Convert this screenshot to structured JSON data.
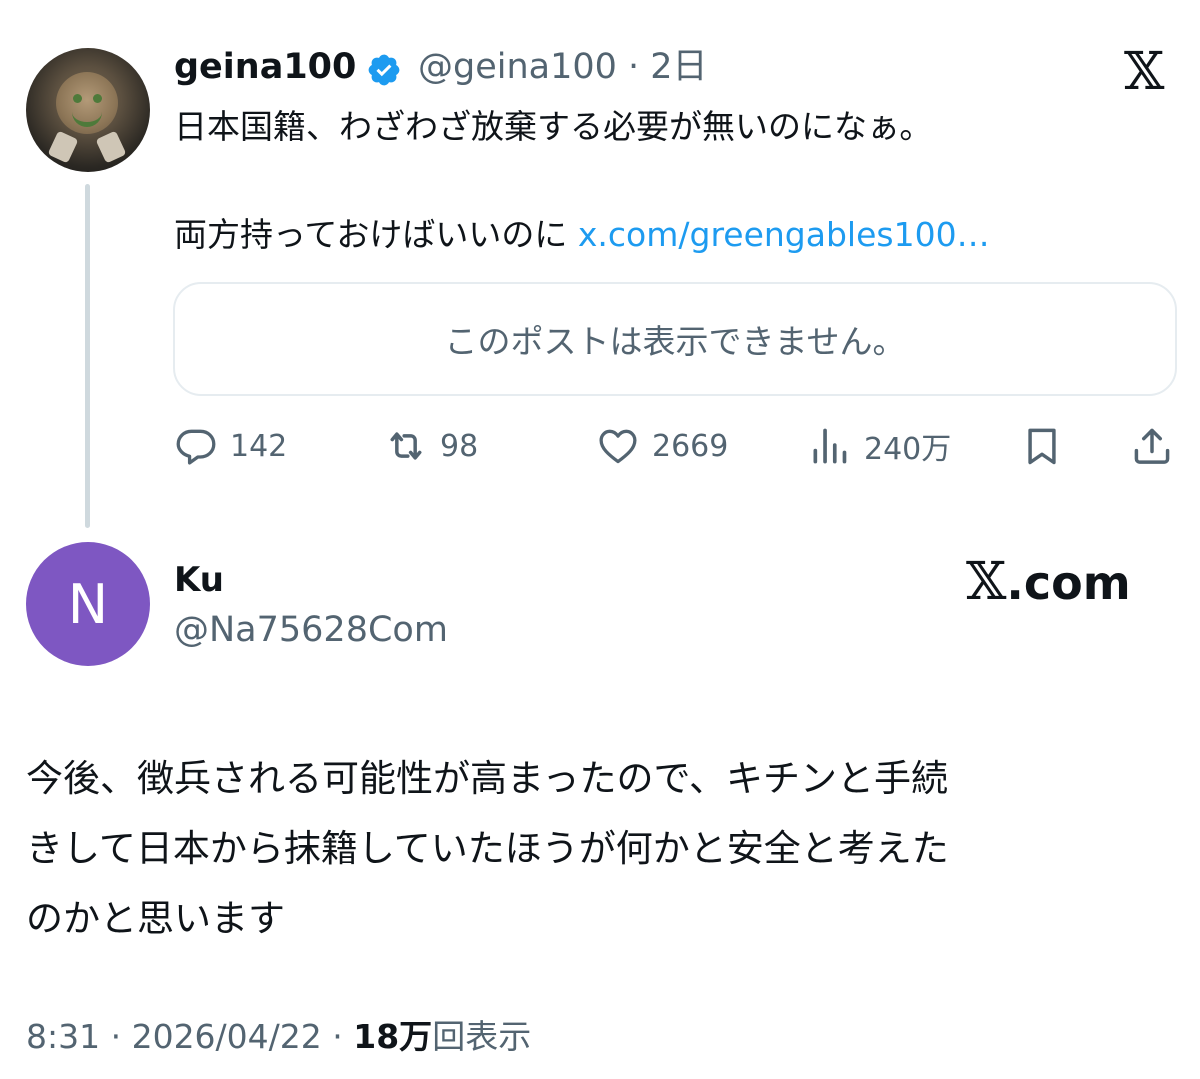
{
  "quoted_tweet": {
    "display_name": "geina100",
    "handle_and_time": "@geina100 · 2日",
    "line1": "日本国籍、わざわざ放棄する必要が無いのになぁ。",
    "line2": "両方持っておけばいいのに",
    "link": "x.com/greengables100…",
    "unavailable_notice": "このポストは表示できません。",
    "metrics": {
      "replies": "142",
      "reposts": "98",
      "likes": "2669",
      "views": "240万"
    },
    "icons": [
      "verified-badge-icon",
      "x-logo-icon",
      "reply-icon",
      "repost-icon",
      "like-icon",
      "views-icon",
      "bookmark-icon",
      "share-icon"
    ],
    "colors": {
      "verified": "#1d9bf0",
      "link": "#1d9bf0"
    }
  },
  "reply_tweet": {
    "avatar_letter": "N",
    "avatar_color": "#7e57c2",
    "display_name": "Ku",
    "handle": "@Na75628Com",
    "brand": ".com",
    "body_lines": [
      "今後、徴兵される可能性が高まったので、キチンと手続",
      "きして日本から抹籍していたほうが何かと安全と考えた",
      "のかと思います"
    ],
    "timestamp": "8:31 · 2026/04/22 · ",
    "views_count": "18万",
    "views_label": "回表示"
  }
}
